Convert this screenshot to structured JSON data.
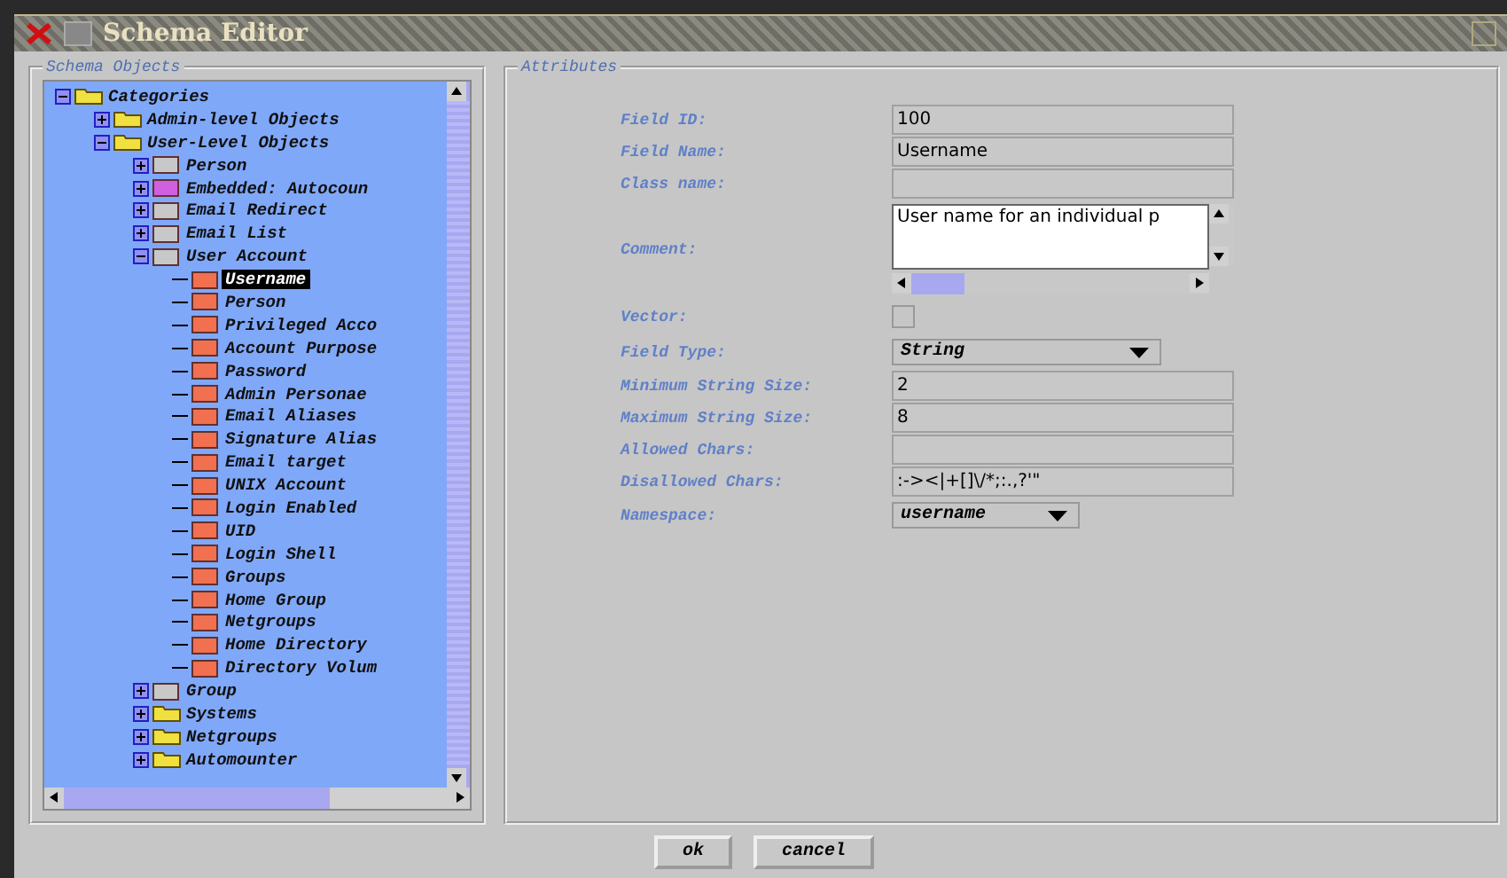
{
  "window": {
    "title": "Schema Editor"
  },
  "tree_panel": {
    "title": "Schema Objects",
    "items": [
      {
        "label": "Categories",
        "kind": "folder",
        "expanded": true,
        "selected": false,
        "children": [
          {
            "label": "Admin-level Objects",
            "kind": "folder",
            "expanded": false,
            "selected": false
          },
          {
            "label": "User-Level Objects",
            "kind": "folder",
            "expanded": true,
            "selected": false,
            "children": [
              {
                "label": "Person",
                "kind": "object",
                "expanded": false,
                "selected": false
              },
              {
                "label": "Embedded: Autocoun",
                "kind": "embedded",
                "expanded": false,
                "selected": false
              },
              {
                "label": "Email Redirect",
                "kind": "object",
                "expanded": false,
                "selected": false
              },
              {
                "label": "Email List",
                "kind": "object",
                "expanded": false,
                "selected": false
              },
              {
                "label": "User Account",
                "kind": "object",
                "expanded": true,
                "selected": false,
                "children": [
                  {
                    "label": "Username",
                    "kind": "field",
                    "selected": true
                  },
                  {
                    "label": "Person",
                    "kind": "field",
                    "selected": false
                  },
                  {
                    "label": "Privileged Acco",
                    "kind": "field",
                    "selected": false
                  },
                  {
                    "label": "Account Purpose",
                    "kind": "field",
                    "selected": false
                  },
                  {
                    "label": "Password",
                    "kind": "field",
                    "selected": false
                  },
                  {
                    "label": "Admin Personae",
                    "kind": "field",
                    "selected": false
                  },
                  {
                    "label": "Email Aliases",
                    "kind": "field",
                    "selected": false
                  },
                  {
                    "label": "Signature Alias",
                    "kind": "field",
                    "selected": false
                  },
                  {
                    "label": "Email target",
                    "kind": "field",
                    "selected": false
                  },
                  {
                    "label": "UNIX Account",
                    "kind": "field",
                    "selected": false
                  },
                  {
                    "label": "Login Enabled",
                    "kind": "field",
                    "selected": false
                  },
                  {
                    "label": "UID",
                    "kind": "field",
                    "selected": false
                  },
                  {
                    "label": "Login Shell",
                    "kind": "field",
                    "selected": false
                  },
                  {
                    "label": "Groups",
                    "kind": "field",
                    "selected": false
                  },
                  {
                    "label": "Home Group",
                    "kind": "field",
                    "selected": false
                  },
                  {
                    "label": "Netgroups",
                    "kind": "field",
                    "selected": false
                  },
                  {
                    "label": "Home Directory",
                    "kind": "field",
                    "selected": false
                  },
                  {
                    "label": "Directory Volum",
                    "kind": "field",
                    "selected": false
                  }
                ]
              },
              {
                "label": "Group",
                "kind": "object",
                "expanded": false,
                "selected": false
              },
              {
                "label": "Systems",
                "kind": "folder",
                "expanded": false,
                "selected": false
              },
              {
                "label": "Netgroups",
                "kind": "folder",
                "expanded": false,
                "selected": false
              },
              {
                "label": "Automounter",
                "kind": "folder",
                "expanded": false,
                "selected": false
              }
            ]
          }
        ]
      }
    ]
  },
  "attributes": {
    "title": "Attributes",
    "fields": [
      {
        "label": "Field ID:",
        "kind": "text",
        "value": "100"
      },
      {
        "label": "Field Name:",
        "kind": "text",
        "value": "Username"
      },
      {
        "label": "Class name:",
        "kind": "text"
      },
      {
        "label": "Comment:",
        "kind": "textarea",
        "value": "User name for an individual p"
      },
      {
        "label": "Vector:",
        "kind": "checkbox",
        "checked": false
      },
      {
        "label": "Field Type:",
        "kind": "dropdown",
        "value": "String"
      },
      {
        "label": "Minimum String Size:",
        "kind": "text",
        "value": "2"
      },
      {
        "label": "Maximum String Size:",
        "kind": "text",
        "value": "8"
      },
      {
        "label": "Allowed Chars:",
        "kind": "text"
      },
      {
        "label": "Disallowed Chars:",
        "kind": "text",
        "value": ":-><|+[]\\/*;:.,?'\""
      },
      {
        "label": "Namespace:",
        "kind": "dropdown",
        "value": "username"
      }
    ]
  },
  "buttons": [
    "ok",
    "cancel"
  ]
}
